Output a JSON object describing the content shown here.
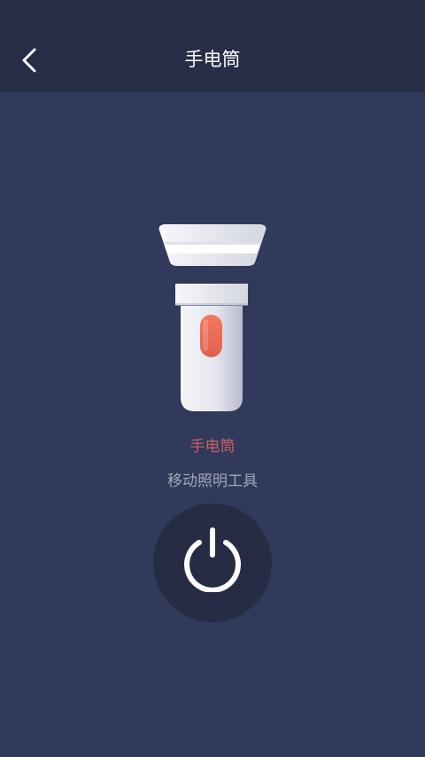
{
  "header": {
    "title": "手电筒",
    "back_icon": "chevron-left-icon"
  },
  "main": {
    "illustration_icon": "flashlight-icon",
    "name": "手电筒",
    "description": "移动照明工具",
    "power_icon": "power-icon"
  },
  "colors": {
    "background": "#313a5a",
    "header": "#282d48",
    "power_button": "#272c45",
    "name_text": "#c95f63",
    "description_text": "#a3a7ba",
    "indicator": "#ee6f5e"
  }
}
